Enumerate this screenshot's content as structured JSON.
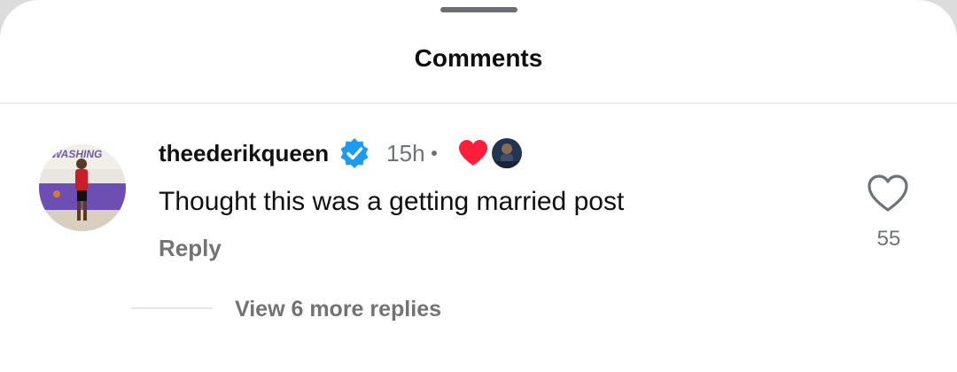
{
  "sheet": {
    "title": "Comments"
  },
  "comment": {
    "username": "theederikqueen",
    "verified": true,
    "timestamp": "15h",
    "text": "Thought this was a getting married post",
    "reply_label": "Reply",
    "like_count": "55",
    "liked_by_author": true,
    "view_replies_label": "View 6 more replies"
  },
  "avatar": {
    "jersey_text": "WASHING"
  },
  "colors": {
    "verified": "#1d9bf0",
    "heart": "#ff1f3a",
    "muted_text": "#737373"
  },
  "icons": {
    "verified": "verified-badge-icon",
    "liked": "heart-filled-icon",
    "like": "heart-outline-icon"
  }
}
